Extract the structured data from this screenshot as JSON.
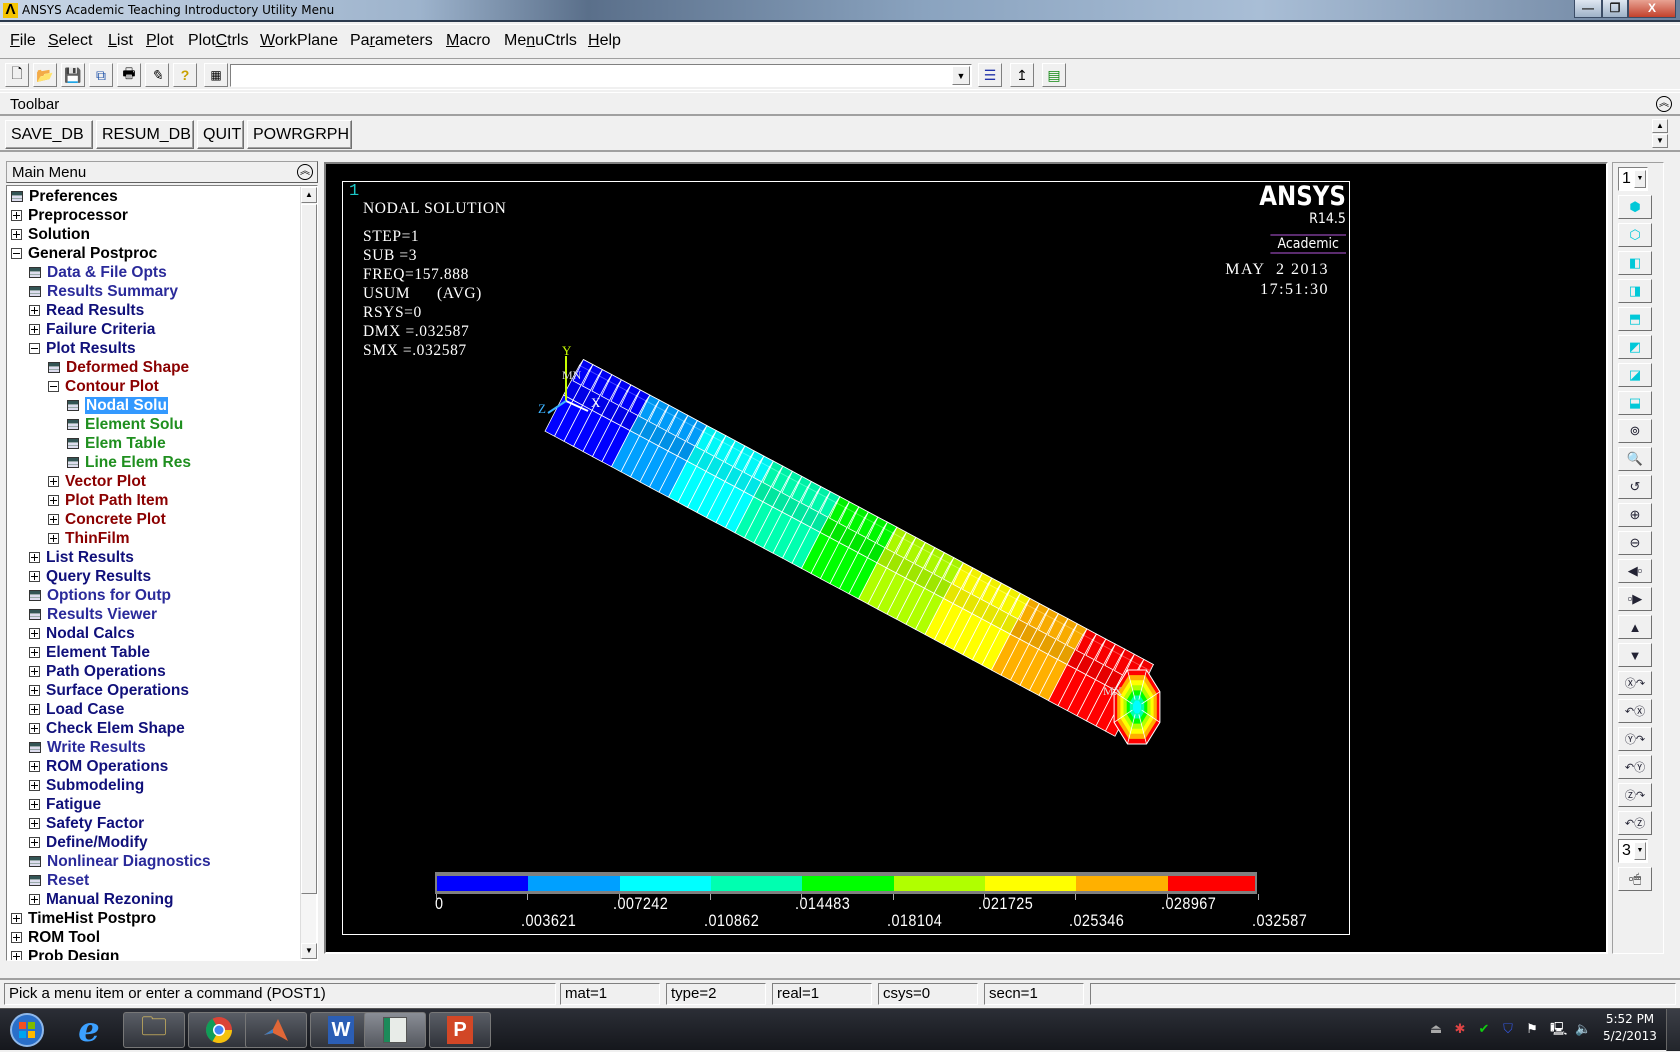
{
  "window": {
    "title": "ANSYS Academic Teaching Introductory Utility Menu",
    "logo_glyph": "Λ",
    "controls": {
      "minimize": "—",
      "maximize": "❐",
      "close": "X"
    }
  },
  "menubar": {
    "items": [
      {
        "label": "File",
        "accel": "F"
      },
      {
        "label": "Select",
        "accel": "S"
      },
      {
        "label": "List",
        "accel": "L"
      },
      {
        "label": "Plot",
        "accel": "P"
      },
      {
        "label": "PlotCtrls",
        "accel": "C"
      },
      {
        "label": "WorkPlane",
        "accel": "W"
      },
      {
        "label": "Parameters",
        "accel": "r"
      },
      {
        "label": "Macro",
        "accel": "M"
      },
      {
        "label": "MenuCtrls",
        "accel": "n"
      },
      {
        "label": "Help",
        "accel": "H"
      }
    ]
  },
  "standard_toolbar": {
    "icons": [
      "new-file-icon",
      "open-folder-icon",
      "save-icon",
      "view-jobname-icon",
      "print-icon",
      "report-generator-icon",
      "help-icon",
      "command-prompt-icon"
    ],
    "command_input": {
      "value": "",
      "placeholder": ""
    },
    "right_icons": [
      "raise-hidden-icon",
      "reset-picking-icon",
      "contact-manager-icon"
    ]
  },
  "toolbar": {
    "label": "Toolbar",
    "buttons": [
      "SAVE_DB",
      "RESUM_DB",
      "QUIT",
      "POWRGRPH"
    ]
  },
  "main_menu": {
    "title": "Main Menu",
    "items": [
      {
        "label": "Preferences",
        "level": 0,
        "icon": "dialog",
        "color": "black"
      },
      {
        "label": "Preprocessor",
        "level": 0,
        "icon": "plus",
        "color": "black"
      },
      {
        "label": "Solution",
        "level": 0,
        "icon": "plus",
        "color": "black"
      },
      {
        "label": "General Postproc",
        "level": 0,
        "icon": "minus",
        "color": "black"
      },
      {
        "label": "Data & File Opts",
        "level": 1,
        "icon": "dialog",
        "color": "lblue"
      },
      {
        "label": "Results Summary",
        "level": 1,
        "icon": "dialog",
        "color": "lblue"
      },
      {
        "label": "Read Results",
        "level": 1,
        "icon": "plus",
        "color": "blue"
      },
      {
        "label": "Failure Criteria",
        "level": 1,
        "icon": "plus",
        "color": "blue"
      },
      {
        "label": "Plot Results",
        "level": 1,
        "icon": "minus",
        "color": "blue"
      },
      {
        "label": "Deformed Shape",
        "level": 2,
        "icon": "dialog",
        "color": "red"
      },
      {
        "label": "Contour Plot",
        "level": 2,
        "icon": "minus",
        "color": "red"
      },
      {
        "label": "Nodal Solu",
        "level": 3,
        "icon": "dialog",
        "color": "green",
        "selected": true
      },
      {
        "label": "Element Solu",
        "level": 3,
        "icon": "dialog",
        "color": "green"
      },
      {
        "label": "Elem Table",
        "level": 3,
        "icon": "dialog",
        "color": "green"
      },
      {
        "label": "Line Elem Res",
        "level": 3,
        "icon": "dialog",
        "color": "green"
      },
      {
        "label": "Vector Plot",
        "level": 2,
        "icon": "plus",
        "color": "red"
      },
      {
        "label": "Plot Path Item",
        "level": 2,
        "icon": "plus",
        "color": "red"
      },
      {
        "label": "Concrete Plot",
        "level": 2,
        "icon": "plus",
        "color": "red"
      },
      {
        "label": "ThinFilm",
        "level": 2,
        "icon": "plus",
        "color": "red"
      },
      {
        "label": "List Results",
        "level": 1,
        "icon": "plus",
        "color": "blue"
      },
      {
        "label": "Query Results",
        "level": 1,
        "icon": "plus",
        "color": "blue"
      },
      {
        "label": "Options for Outp",
        "level": 1,
        "icon": "dialog",
        "color": "lblue"
      },
      {
        "label": "Results Viewer",
        "level": 1,
        "icon": "dialog",
        "color": "lblue"
      },
      {
        "label": "Nodal Calcs",
        "level": 1,
        "icon": "plus",
        "color": "blue"
      },
      {
        "label": "Element Table",
        "level": 1,
        "icon": "plus",
        "color": "blue"
      },
      {
        "label": "Path Operations",
        "level": 1,
        "icon": "plus",
        "color": "blue"
      },
      {
        "label": "Surface Operations",
        "level": 1,
        "icon": "plus",
        "color": "blue"
      },
      {
        "label": "Load Case",
        "level": 1,
        "icon": "plus",
        "color": "blue"
      },
      {
        "label": "Check Elem Shape",
        "level": 1,
        "icon": "plus",
        "color": "blue"
      },
      {
        "label": "Write Results",
        "level": 1,
        "icon": "dialog",
        "color": "lblue"
      },
      {
        "label": "ROM Operations",
        "level": 1,
        "icon": "plus",
        "color": "blue"
      },
      {
        "label": "Submodeling",
        "level": 1,
        "icon": "plus",
        "color": "blue"
      },
      {
        "label": "Fatigue",
        "level": 1,
        "icon": "plus",
        "color": "blue"
      },
      {
        "label": "Safety Factor",
        "level": 1,
        "icon": "plus",
        "color": "blue"
      },
      {
        "label": "Define/Modify",
        "level": 1,
        "icon": "plus",
        "color": "blue"
      },
      {
        "label": "Nonlinear Diagnostics",
        "level": 1,
        "icon": "dialog",
        "color": "lblue"
      },
      {
        "label": "Reset",
        "level": 1,
        "icon": "dialog",
        "color": "lblue"
      },
      {
        "label": "Manual Rezoning",
        "level": 1,
        "icon": "plus",
        "color": "blue"
      },
      {
        "label": "TimeHist Postpro",
        "level": 0,
        "icon": "plus",
        "color": "black"
      },
      {
        "label": "ROM Tool",
        "level": 0,
        "icon": "plus",
        "color": "black"
      },
      {
        "label": "Prob Design",
        "level": 0,
        "icon": "plus",
        "color": "black"
      }
    ]
  },
  "graphics": {
    "window_number": "1",
    "plot_title": "NODAL SOLUTION",
    "info_lines": [
      "STEP=1",
      "SUB =3",
      "FREQ=157.888",
      "USUM      (AVG)",
      "RSYS=0",
      "DMX =.032587",
      "SMX =.032587"
    ],
    "brand": "ANSYS",
    "version": "R14.5",
    "license": "Academic",
    "date": "MAY  2 2013",
    "time": "17:51:30",
    "triad_labels": {
      "y": "Y",
      "x": "X",
      "z": "Z"
    },
    "min_label": "MN",
    "max_label": "MX",
    "legend": {
      "colors": [
        "#0000ff",
        "#00a0ff",
        "#00ffff",
        "#00ffb0",
        "#00ff00",
        "#b0ff00",
        "#ffff00",
        "#ffb000",
        "#ff0000"
      ],
      "labels": [
        "0",
        ".003621",
        ".007242",
        ".010862",
        ".014483",
        ".018104",
        ".021725",
        ".025346",
        ".028967",
        ".032587"
      ],
      "min": 0,
      "max": 0.032587
    }
  },
  "right_toolbar": {
    "window_select": "1",
    "buttons": [
      "iso-view-icon",
      "oblique-view-icon",
      "front-view-icon",
      "right-view-icon",
      "top-view-icon",
      "back-view-icon",
      "left-view-icon",
      "bottom-view-icon",
      "zoom-icon",
      "box-zoom-icon",
      "back-up-zoom-icon",
      "zoom-in-icon",
      "zoom-out-icon",
      "pan-left-icon",
      "pan-right-icon",
      "pan-up-icon",
      "pan-down-icon",
      "rotate-x-pos-icon",
      "rotate-x-neg-icon",
      "rotate-y-pos-icon",
      "rotate-y-neg-icon",
      "rotate-z-pos-icon",
      "rotate-z-neg-icon"
    ],
    "rate_select": "3",
    "dynamic_mode_icon": "dynamic-model-mode-icon"
  },
  "status_bar": {
    "prompt": "Pick a menu item or enter a command (POST1)",
    "mat": "mat=1",
    "type": "type=2",
    "real": "real=1",
    "csys": "csys=0",
    "secn": "secn=1"
  },
  "taskbar": {
    "apps": [
      "start-button",
      "internet-explorer",
      "windows-explorer",
      "google-chrome",
      "matlab",
      "microsoft-word",
      "ansys",
      "microsoft-powerpoint"
    ],
    "clock_time": "5:52 PM",
    "clock_date": "5/2/2013"
  }
}
